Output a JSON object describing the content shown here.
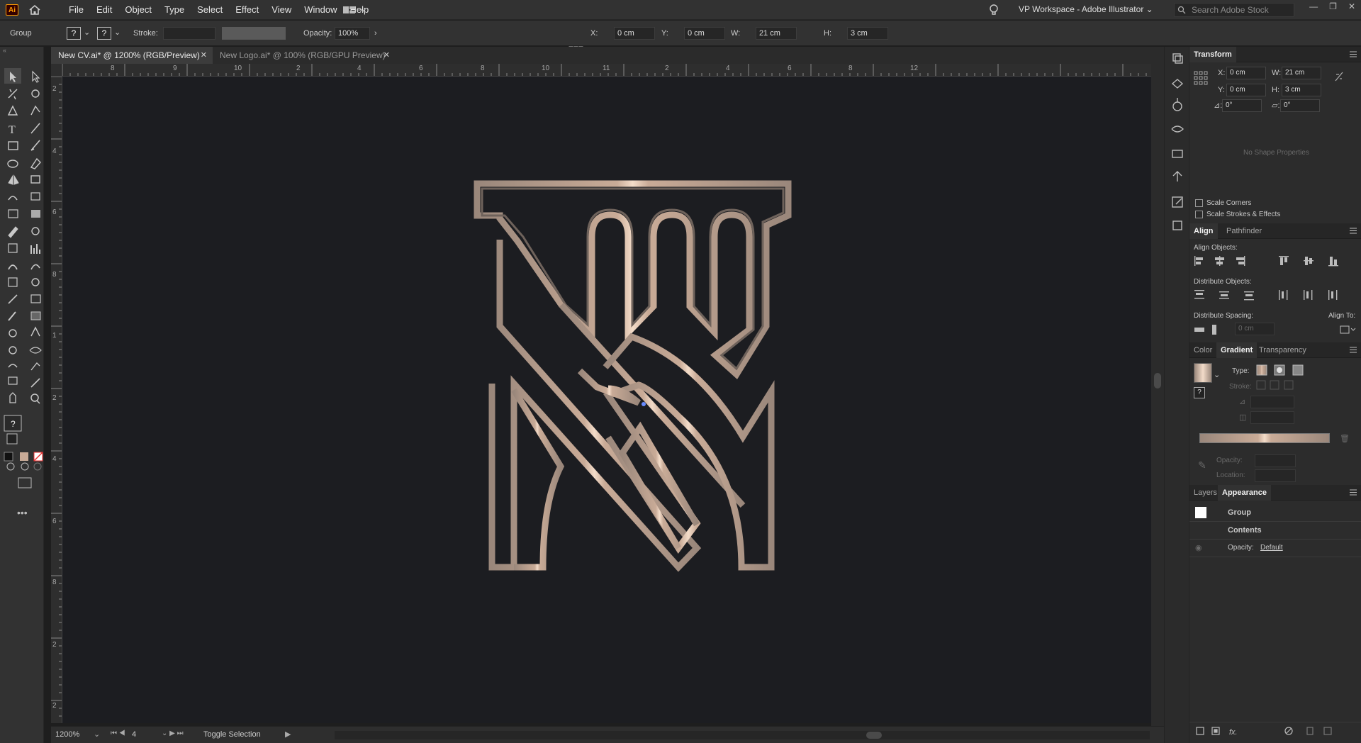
{
  "app": {
    "logo": "Ai",
    "workspace": "VP Workspace - Adobe Illustrator",
    "search_placeholder": "Search Adobe Stock"
  },
  "menus": [
    "File",
    "Edit",
    "Object",
    "Type",
    "Select",
    "Effect",
    "View",
    "Window",
    "Help"
  ],
  "control": {
    "selection": "Group",
    "stroke_label": "Stroke:",
    "opacity_label": "Opacity:",
    "opacity_value": "100%",
    "x_label": "X:",
    "x_value": "0 cm",
    "y_label": "Y:",
    "y_value": "0 cm",
    "w_label": "W:",
    "w_value": "21 cm",
    "h_label": "H:",
    "h_value": "3 cm"
  },
  "tabs": [
    {
      "label": "New CV.ai* @ 1200% (RGB/Preview)",
      "active": true
    },
    {
      "label": "New Logo.ai* @ 100% (RGB/GPU Preview)",
      "active": false
    }
  ],
  "ruler_top_labels": [
    "8",
    "9",
    "10",
    "2",
    "4",
    "6",
    "8",
    "10",
    "11",
    "2",
    "4",
    "6",
    "8",
    "12"
  ],
  "ruler_left_labels": [
    "2",
    "4",
    "6",
    "8",
    "1",
    "2",
    "4",
    "6",
    "8",
    "2",
    "2"
  ],
  "status": {
    "zoom": "1200%",
    "artboard": "4",
    "tool": "Toggle Selection"
  },
  "transform": {
    "title": "Transform",
    "x": "0 cm",
    "y": "0 cm",
    "w": "21 cm",
    "h": "3 cm",
    "angle": "0°",
    "shear": "0°",
    "no_shape": "No Shape Properties",
    "scale_corners": "Scale Corners",
    "scale_strokes": "Scale Strokes & Effects"
  },
  "align": {
    "tabs": [
      "Align",
      "Pathfinder"
    ],
    "align_objects": "Align Objects:",
    "distribute_objects": "Distribute Objects:",
    "distribute_spacing": "Distribute Spacing:",
    "align_to": "Align To:",
    "spacing_value": "0 cm"
  },
  "gradient": {
    "tabs": [
      "Color",
      "Gradient",
      "Transparency"
    ],
    "type_label": "Type:",
    "stroke_label": "Stroke:",
    "opacity_label": "Opacity:",
    "location_label": "Location:",
    "colors": {
      "light": "#f3dcc9",
      "mid": "#c9ab97",
      "dark": "#9a877b"
    }
  },
  "appearance": {
    "tabs": [
      "Layers",
      "Appearance"
    ],
    "title": "Group",
    "contents": "Contents",
    "opacity_label": "Opacity:",
    "opacity_value": "Default"
  }
}
